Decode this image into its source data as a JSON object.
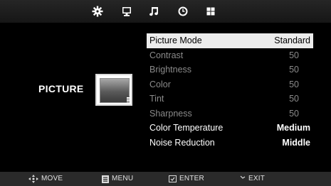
{
  "top_bar": {
    "tabs": [
      {
        "icon": "gear-icon"
      },
      {
        "icon": "monitor-icon"
      },
      {
        "icon": "music-note-icon"
      },
      {
        "icon": "clock-icon"
      },
      {
        "icon": "grid-icon"
      }
    ]
  },
  "section": {
    "title": "PICTURE",
    "icon": "tv-picture-icon"
  },
  "menu": {
    "items": [
      {
        "label": "Picture Mode",
        "value": "Standard"
      },
      {
        "label": "Contrast",
        "value": "50"
      },
      {
        "label": "Brightness",
        "value": "50"
      },
      {
        "label": "Color",
        "value": "50"
      },
      {
        "label": "Tint",
        "value": "50"
      },
      {
        "label": "Sharpness",
        "value": "50"
      },
      {
        "label": "Color Temperature",
        "value": "Medium"
      },
      {
        "label": "Noise Reduction",
        "value": "Middle"
      }
    ]
  },
  "bottom_bar": {
    "move_label": "MOVE",
    "menu_label": "MENU",
    "enter_label": "ENTER",
    "exit_label": "EXIT"
  }
}
